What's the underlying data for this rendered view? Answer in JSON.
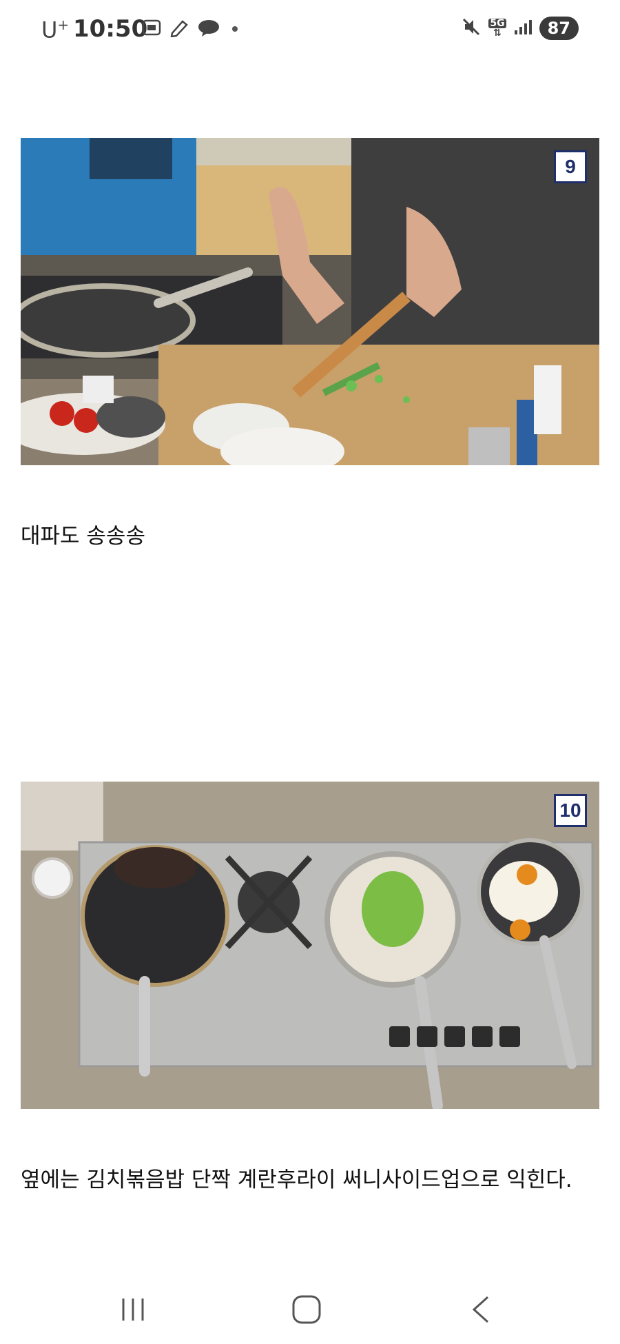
{
  "status_bar": {
    "carrier": "U",
    "carrier_sup": "+",
    "time": "10:50",
    "left_icons": [
      "screenshot-icon",
      "pen-icon",
      "chat-icon",
      "dot-icon"
    ],
    "right_icons": [
      "mute-icon",
      "5g-icon",
      "signal-icon"
    ],
    "network_label": "5G",
    "battery": "87"
  },
  "article": {
    "photos": [
      {
        "badge": "9",
        "description": "chopping-green-onion"
      },
      {
        "badge": "10",
        "description": "stovetop-pans"
      }
    ],
    "captions": [
      "대파도 송송송",
      "옆에는 김치볶음밥 단짝 계란후라이 써니사이드업으로 익힌다."
    ]
  },
  "nav_bar": {
    "buttons": [
      "recent-apps",
      "home",
      "back"
    ]
  },
  "colors": {
    "badge_border": "#1f2f6b",
    "background": "#ffffff"
  }
}
